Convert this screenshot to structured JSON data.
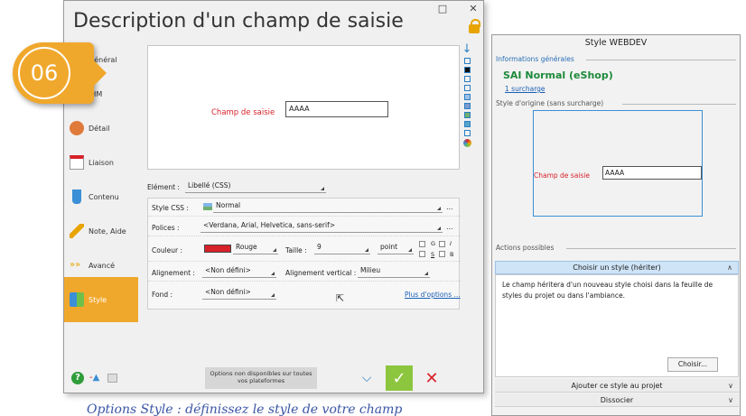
{
  "dialog": {
    "title": "Description d'un champ de saisie",
    "sidebar": [
      {
        "label": "Général",
        "icon": "general-icon"
      },
      {
        "label": "IHM",
        "icon": "ihm-icon"
      },
      {
        "label": "Détail",
        "icon": "detail-icon"
      },
      {
        "label": "Liaison",
        "icon": "liaison-icon"
      },
      {
        "label": "Contenu",
        "icon": "contenu-icon"
      },
      {
        "label": "Note, Aide",
        "icon": "note-icon"
      },
      {
        "label": "Avancé",
        "icon": "avance-icon"
      },
      {
        "label": "Style",
        "icon": "style-icon"
      }
    ],
    "preview": {
      "label": "Champ de saisie",
      "value": "AAAA"
    },
    "element": {
      "label": "Elément :",
      "value": "Libellé (CSS)"
    },
    "props": {
      "style_css_label": "Style CSS :",
      "style_css_value": "Normal",
      "polices_label": "Polices :",
      "polices_value": "<Verdana, Arial, Helvetica, sans-serif>",
      "couleur_label": "Couleur :",
      "couleur_value": "Rouge",
      "couleur_hex": "#d8222a",
      "taille_label": "Taille :",
      "taille_value": "9",
      "unite_value": "point",
      "g_label": "G",
      "i_label": "I",
      "s_label": "S",
      "b_label": "B",
      "align_label": "Alignement :",
      "align_value": "<Non défini>",
      "valign_label": "Alignement vertical :",
      "valign_value": "Milieu",
      "fond_label": "Fond :",
      "fond_value": "<Non défini>",
      "more_link": "Plus d'options ..."
    },
    "footer_note": "Options non disponibles sur toutes vos plateformes"
  },
  "badge": {
    "text": "06",
    "color": "#f0a82c"
  },
  "panel": {
    "title": "Style WEBDEV",
    "info_section": "Informations générales",
    "style_name": "SAI Normal (eShop)",
    "surcharge_link": "1 surcharge",
    "origin_section": "Style d'origine (sans surcharge)",
    "preview_label": "Champ de saisie",
    "preview_value": "AAAA",
    "actions_section": "Actions possibles",
    "action_inherit": "Choisir un style (hériter)",
    "action_inherit_desc": "Le champ héritera d'un nouveau style choisi dans la feuille de styles du projet ou dans l'ambiance.",
    "choose_button": "Choisir...",
    "action_add": "Ajouter ce style au projet",
    "action_dissociate": "Dissocier"
  },
  "caption": "Options Style : définissez le style de votre champ"
}
